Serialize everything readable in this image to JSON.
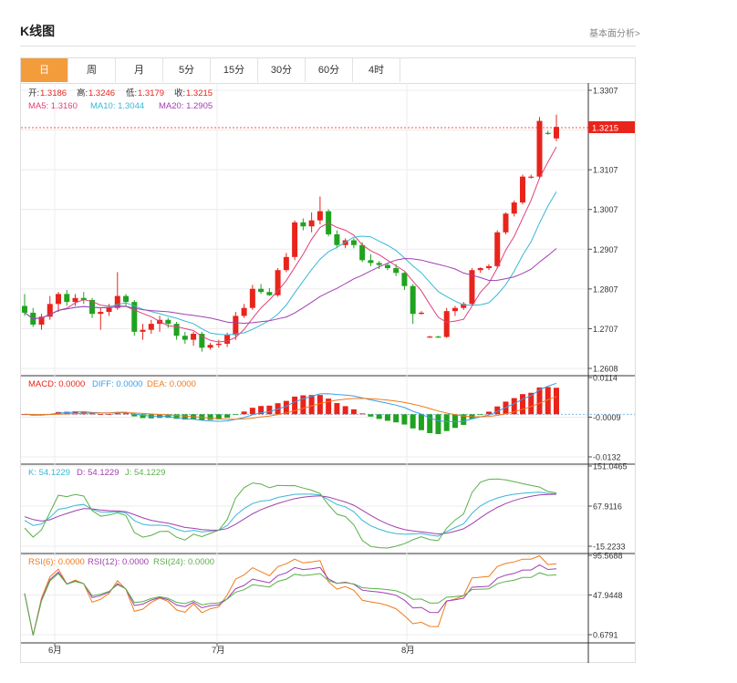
{
  "header": {
    "title": "K线图",
    "link": "基本面分析>"
  },
  "tabs": [
    "日",
    "周",
    "月",
    "5分",
    "15分",
    "30分",
    "60分",
    "4时"
  ],
  "active_tab": 0,
  "info": {
    "open_label": "开:",
    "open": "1.3186",
    "high_label": "高:",
    "high": "1.3246",
    "low_label": "低:",
    "low": "1.3179",
    "close_label": "收:",
    "close": "1.3215",
    "ma5": "MA5: 1.3160",
    "ma10": "MA10: 1.3044",
    "ma20": "MA20: 1.2905"
  },
  "last_price": "1.3215",
  "colors": {
    "up": "#e8241b",
    "down": "#1fa31f",
    "ma5": "#e0407a",
    "ma10": "#39b8d6",
    "ma20": "#a040b0",
    "accent": "#f39c3c"
  },
  "months": [
    "6月",
    "7月",
    "8月"
  ],
  "macd_labels": {
    "macd": "MACD: 0.0000",
    "diff": "DIFF: 0.0000",
    "dea": "DEA: 0.0000"
  },
  "kdj_labels": {
    "k": "K: 54.1229",
    "d": "D: 54.1229",
    "j": "J: 54.1229"
  },
  "rsi_labels": {
    "r6": "RSI(6): 0.0000",
    "r12": "RSI(12): 0.0000",
    "r24": "RSI(24): 0.0000"
  },
  "chart_data": {
    "type": "candlestick",
    "price_axis": {
      "ticks": [
        "1.3307",
        "1.3207",
        "1.3107",
        "1.3007",
        "1.2907",
        "1.2807",
        "1.2707",
        "1.2608"
      ],
      "min": 1.2608,
      "max": 1.3307
    },
    "macd_axis": {
      "ticks": [
        "0.0114",
        "-0.0009",
        "-0.0132"
      ],
      "min": -0.0132,
      "max": 0.0114
    },
    "kdj_axis": {
      "ticks": [
        "151.0465",
        "67.9116",
        "-15.2233"
      ],
      "min": -15.2233,
      "max": 151.0465
    },
    "rsi_axis": {
      "ticks": [
        "95.5688",
        "47.9448",
        "0.6791"
      ],
      "min": 0.6791,
      "max": 95.5688
    },
    "candles": [
      [
        1.2765,
        1.2748,
        1.2795,
        1.274
      ],
      [
        1.2748,
        1.2718,
        1.276,
        1.2712
      ],
      [
        1.2718,
        1.2738,
        1.2745,
        1.2705
      ],
      [
        1.2738,
        1.277,
        1.279,
        1.273
      ],
      [
        1.277,
        1.2795,
        1.28,
        1.275
      ],
      [
        1.2795,
        1.2775,
        1.2805,
        1.2765
      ],
      [
        1.2775,
        1.2785,
        1.2795,
        1.2765
      ],
      [
        1.2785,
        1.278,
        1.28,
        1.277
      ],
      [
        1.278,
        1.2745,
        1.2785,
        1.2735
      ],
      [
        1.2745,
        1.275,
        1.276,
        1.2705
      ],
      [
        1.275,
        1.276,
        1.277,
        1.274
      ],
      [
        1.276,
        1.279,
        1.285,
        1.2755
      ],
      [
        1.279,
        1.2775,
        1.2795,
        1.2765
      ],
      [
        1.2775,
        1.27,
        1.278,
        1.269
      ],
      [
        1.27,
        1.2705,
        1.272,
        1.268
      ],
      [
        1.2705,
        1.272,
        1.273,
        1.2695
      ],
      [
        1.272,
        1.273,
        1.274,
        1.27
      ],
      [
        1.273,
        1.272,
        1.2735,
        1.271
      ],
      [
        1.272,
        1.269,
        1.2725,
        1.268
      ],
      [
        1.269,
        1.268,
        1.27,
        1.267
      ],
      [
        1.268,
        1.2695,
        1.27,
        1.2665
      ],
      [
        1.2695,
        1.266,
        1.27,
        1.265
      ],
      [
        1.266,
        1.2667,
        1.2672,
        1.2655
      ],
      [
        1.2667,
        1.267,
        1.268,
        1.266
      ],
      [
        1.267,
        1.2692,
        1.2698,
        1.2662
      ],
      [
        1.2692,
        1.274,
        1.275,
        1.268
      ],
      [
        1.274,
        1.276,
        1.277,
        1.2735
      ],
      [
        1.276,
        1.2808,
        1.2818,
        1.2755
      ],
      [
        1.2808,
        1.28,
        1.282,
        1.2795
      ],
      [
        1.28,
        1.2792,
        1.281,
        1.279
      ],
      [
        1.2792,
        1.2855,
        1.286,
        1.2788
      ],
      [
        1.2855,
        1.2888,
        1.2898,
        1.285
      ],
      [
        1.2888,
        1.2975,
        1.298,
        1.288
      ],
      [
        1.2975,
        1.2965,
        1.2985,
        1.2955
      ],
      [
        1.2965,
        1.298,
        1.3,
        1.295
      ],
      [
        1.298,
        1.3003,
        1.304,
        1.297
      ],
      [
        1.3003,
        1.2945,
        1.3008,
        1.294
      ],
      [
        1.2945,
        1.2918,
        1.2955,
        1.291
      ],
      [
        1.2918,
        1.293,
        1.2935,
        1.291
      ],
      [
        1.293,
        1.2918,
        1.2935,
        1.291
      ],
      [
        1.2918,
        1.288,
        1.2925,
        1.2875
      ],
      [
        1.288,
        1.2873,
        1.2895,
        1.2865
      ],
      [
        1.2873,
        1.2868,
        1.2878,
        1.2858
      ],
      [
        1.2868,
        1.286,
        1.2872,
        1.2855
      ],
      [
        1.286,
        1.2848,
        1.287,
        1.284
      ],
      [
        1.2848,
        1.2815,
        1.285,
        1.2805
      ],
      [
        1.2815,
        1.2745,
        1.282,
        1.272
      ],
      [
        1.2745,
        1.2748,
        1.2752,
        1.2743
      ],
      [
        1.2688,
        1.2688,
        1.269,
        1.2686
      ],
      [
        1.2688,
        1.2687,
        1.269,
        1.2685
      ],
      [
        1.2687,
        1.2752,
        1.276,
        1.2685
      ],
      [
        1.2752,
        1.276,
        1.2765,
        1.274
      ],
      [
        1.276,
        1.277,
        1.2775,
        1.2755
      ],
      [
        1.277,
        1.2855,
        1.286,
        1.2765
      ],
      [
        1.2855,
        1.286,
        1.2862,
        1.2848
      ],
      [
        1.286,
        1.2865,
        1.287,
        1.2855
      ],
      [
        1.2865,
        1.295,
        1.2955,
        1.286
      ],
      [
        1.295,
        1.2997,
        1.3,
        1.2945
      ],
      [
        1.2997,
        1.3025,
        1.303,
        1.299
      ],
      [
        1.3025,
        1.309,
        1.3095,
        1.302
      ],
      [
        1.309,
        1.309,
        1.3095,
        1.3085
      ],
      [
        1.309,
        1.323,
        1.324,
        1.3085
      ],
      [
        1.32,
        1.3198,
        1.3205,
        1.3195
      ],
      [
        1.3186,
        1.3215,
        1.3246,
        1.3179
      ]
    ]
  }
}
